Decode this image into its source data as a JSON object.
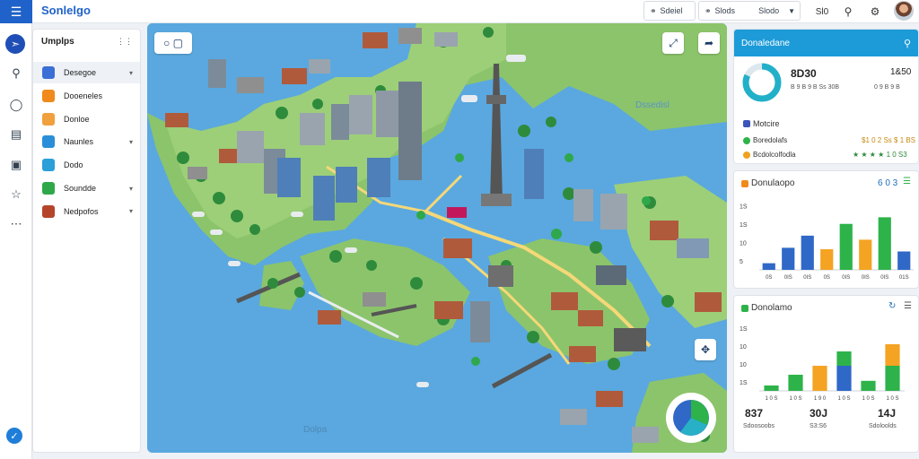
{
  "app": {
    "title": "Sonlelgo"
  },
  "topbar": {
    "search_label": "Sdeiel",
    "location_label": "Slods",
    "location_value": "Slodo",
    "code": "Sl0",
    "icons": [
      "search-icon",
      "bell-icon",
      "avatar"
    ]
  },
  "sidebar": {
    "heading": "Umplps",
    "items": [
      {
        "label": "Desegoe",
        "icon": "layers-icon",
        "color": "#3b6fd6",
        "chevron": true
      },
      {
        "label": "Dooeneles",
        "icon": "orange-square-icon",
        "color": "#f08a1c",
        "chevron": false
      },
      {
        "label": "Donloe",
        "icon": "folder-icon",
        "color": "#f0a03c",
        "chevron": false
      },
      {
        "label": "Naunles",
        "icon": "water-icon",
        "color": "#2a8fd8",
        "chevron": true
      },
      {
        "label": "Dodo",
        "icon": "globe-icon",
        "color": "#2a9fd8",
        "chevron": false
      },
      {
        "label": "Soundde",
        "icon": "green-doc-icon",
        "color": "#2ea84b",
        "chevron": true
      },
      {
        "label": "Nedpofos",
        "icon": "brown-book-icon",
        "color": "#b5452a",
        "chevron": true
      }
    ]
  },
  "map": {
    "bottom_label": "Dolpa",
    "water_label": "Dssedisl",
    "controls": [
      "expand-icon",
      "share-icon",
      "navigate-icon"
    ]
  },
  "summary": {
    "header": "Donaledane",
    "donut": {
      "value": 0.82,
      "color": "#22b0c9"
    },
    "main_value": "8D30",
    "main_sub": "B 9 B 9 B Ss 30B",
    "side_value": "1&50",
    "side_sub": "0 9 B 9 B",
    "legend_title": "Motcire",
    "rows": [
      {
        "label": "Boredolafs",
        "value": "$1 0 2 Ss $ 1 BS",
        "color": "#2db34a"
      },
      {
        "label": "Bcdolcolfodla",
        "value": "★ ★ ★ ★ 1 0 S3",
        "color": "#f0a21f"
      }
    ]
  },
  "chart1": {
    "title": "Donulaopo",
    "value": "6 0 3",
    "chart_data": {
      "type": "bar",
      "ylim": [
        0,
        20
      ],
      "yticks": [
        "1S",
        "1S",
        "10",
        "5"
      ],
      "categories": [
        "0S",
        "0IS",
        "0IS",
        "0S",
        "0IS",
        "0IS",
        "0IS",
        "01S"
      ],
      "values": [
        1.8,
        6,
        9.3,
        5.6,
        12.5,
        8.2,
        14.3,
        5
      ],
      "colors": [
        "#2f68c7",
        "#2f68c7",
        "#2f68c7",
        "#f4a322",
        "#2db34a",
        "#f4a322",
        "#2db34a",
        "#2f68c7"
      ]
    }
  },
  "chart2": {
    "title": "Donolamo",
    "chart_data": {
      "type": "bar",
      "ylim": [
        0,
        20
      ],
      "yticks": [
        "1S",
        "10",
        "10",
        "1S"
      ],
      "categories": [
        "1 0 S",
        "1 0 S",
        "1 9 0",
        "1 0 S",
        "1 0 S",
        "1 0 S"
      ],
      "stacks": [
        [
          {
            "v": 1.5,
            "c": "#2db34a"
          }
        ],
        [
          {
            "v": 4.5,
            "c": "#2db34a"
          }
        ],
        [
          {
            "v": 7,
            "c": "#f4a322"
          }
        ],
        [
          {
            "v": 7,
            "c": "#2f68c7"
          },
          {
            "v": 4,
            "c": "#2db34a"
          }
        ],
        [
          {
            "v": 2.8,
            "c": "#2db34a"
          }
        ],
        [
          {
            "v": 7,
            "c": "#2db34a"
          },
          {
            "v": 6,
            "c": "#f4a322"
          }
        ]
      ]
    },
    "stats": [
      {
        "value": "837",
        "sub": "Sdoosoobs"
      },
      {
        "value": "30J",
        "sub": "S3:S6"
      },
      {
        "value": "14J",
        "sub": "Sdoloolds"
      }
    ]
  }
}
